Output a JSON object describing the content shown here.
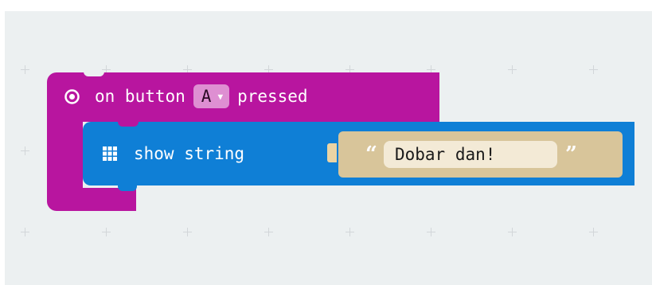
{
  "event_block": {
    "label_prefix": "on button",
    "button_value": "A",
    "label_suffix": "pressed",
    "color": "#b8159f"
  },
  "statement_block": {
    "label": "show string",
    "color": "#0f7fd6"
  },
  "string_block": {
    "open_quote": "“",
    "value": "Dobar dan!",
    "close_quote": "”",
    "color": "#d8c59a"
  },
  "icons": {
    "event": "target-icon",
    "statement": "led-grid-icon",
    "dropdown": "dropdown-arrow-icon"
  }
}
